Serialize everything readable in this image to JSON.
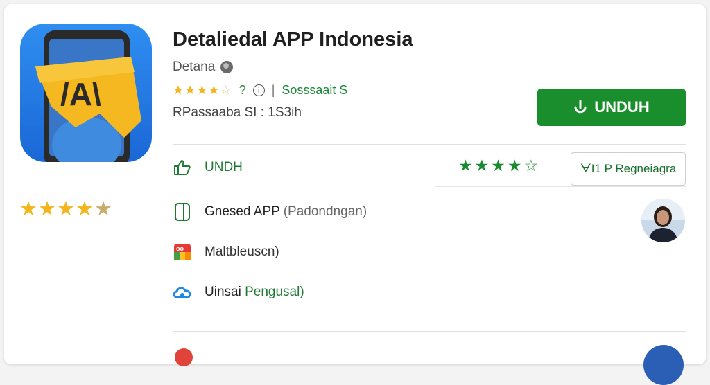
{
  "app": {
    "title": "Detaliedal APP Indonesia",
    "developer": "Detana",
    "rating_number": "?",
    "separator": "|",
    "downloads": "Sosssaait S",
    "meta": "RPassaaba SI  :  1S3ih"
  },
  "download_button": {
    "label": "UNDUH"
  },
  "rows": {
    "action_label": "UNDH",
    "shared_label": "Gnesed APP",
    "shared_sub": "(Padondngan)",
    "multi_label": "Maltbleuscn)",
    "user_label": "Uinsai",
    "user_sub": "Pengusal)"
  },
  "report_button": {
    "label": "ᗄI1 P Regneiagra"
  },
  "icons": [
    "app-logo-icon",
    "globe-icon",
    "info-icon",
    "download-icon",
    "thumbs-up-icon",
    "tablet-icon",
    "multiapp-icon",
    "cloud-icon"
  ],
  "colors": {
    "accent": "#1a8d2d",
    "star": "#f2b51b",
    "green_text": "#1e7a33"
  }
}
